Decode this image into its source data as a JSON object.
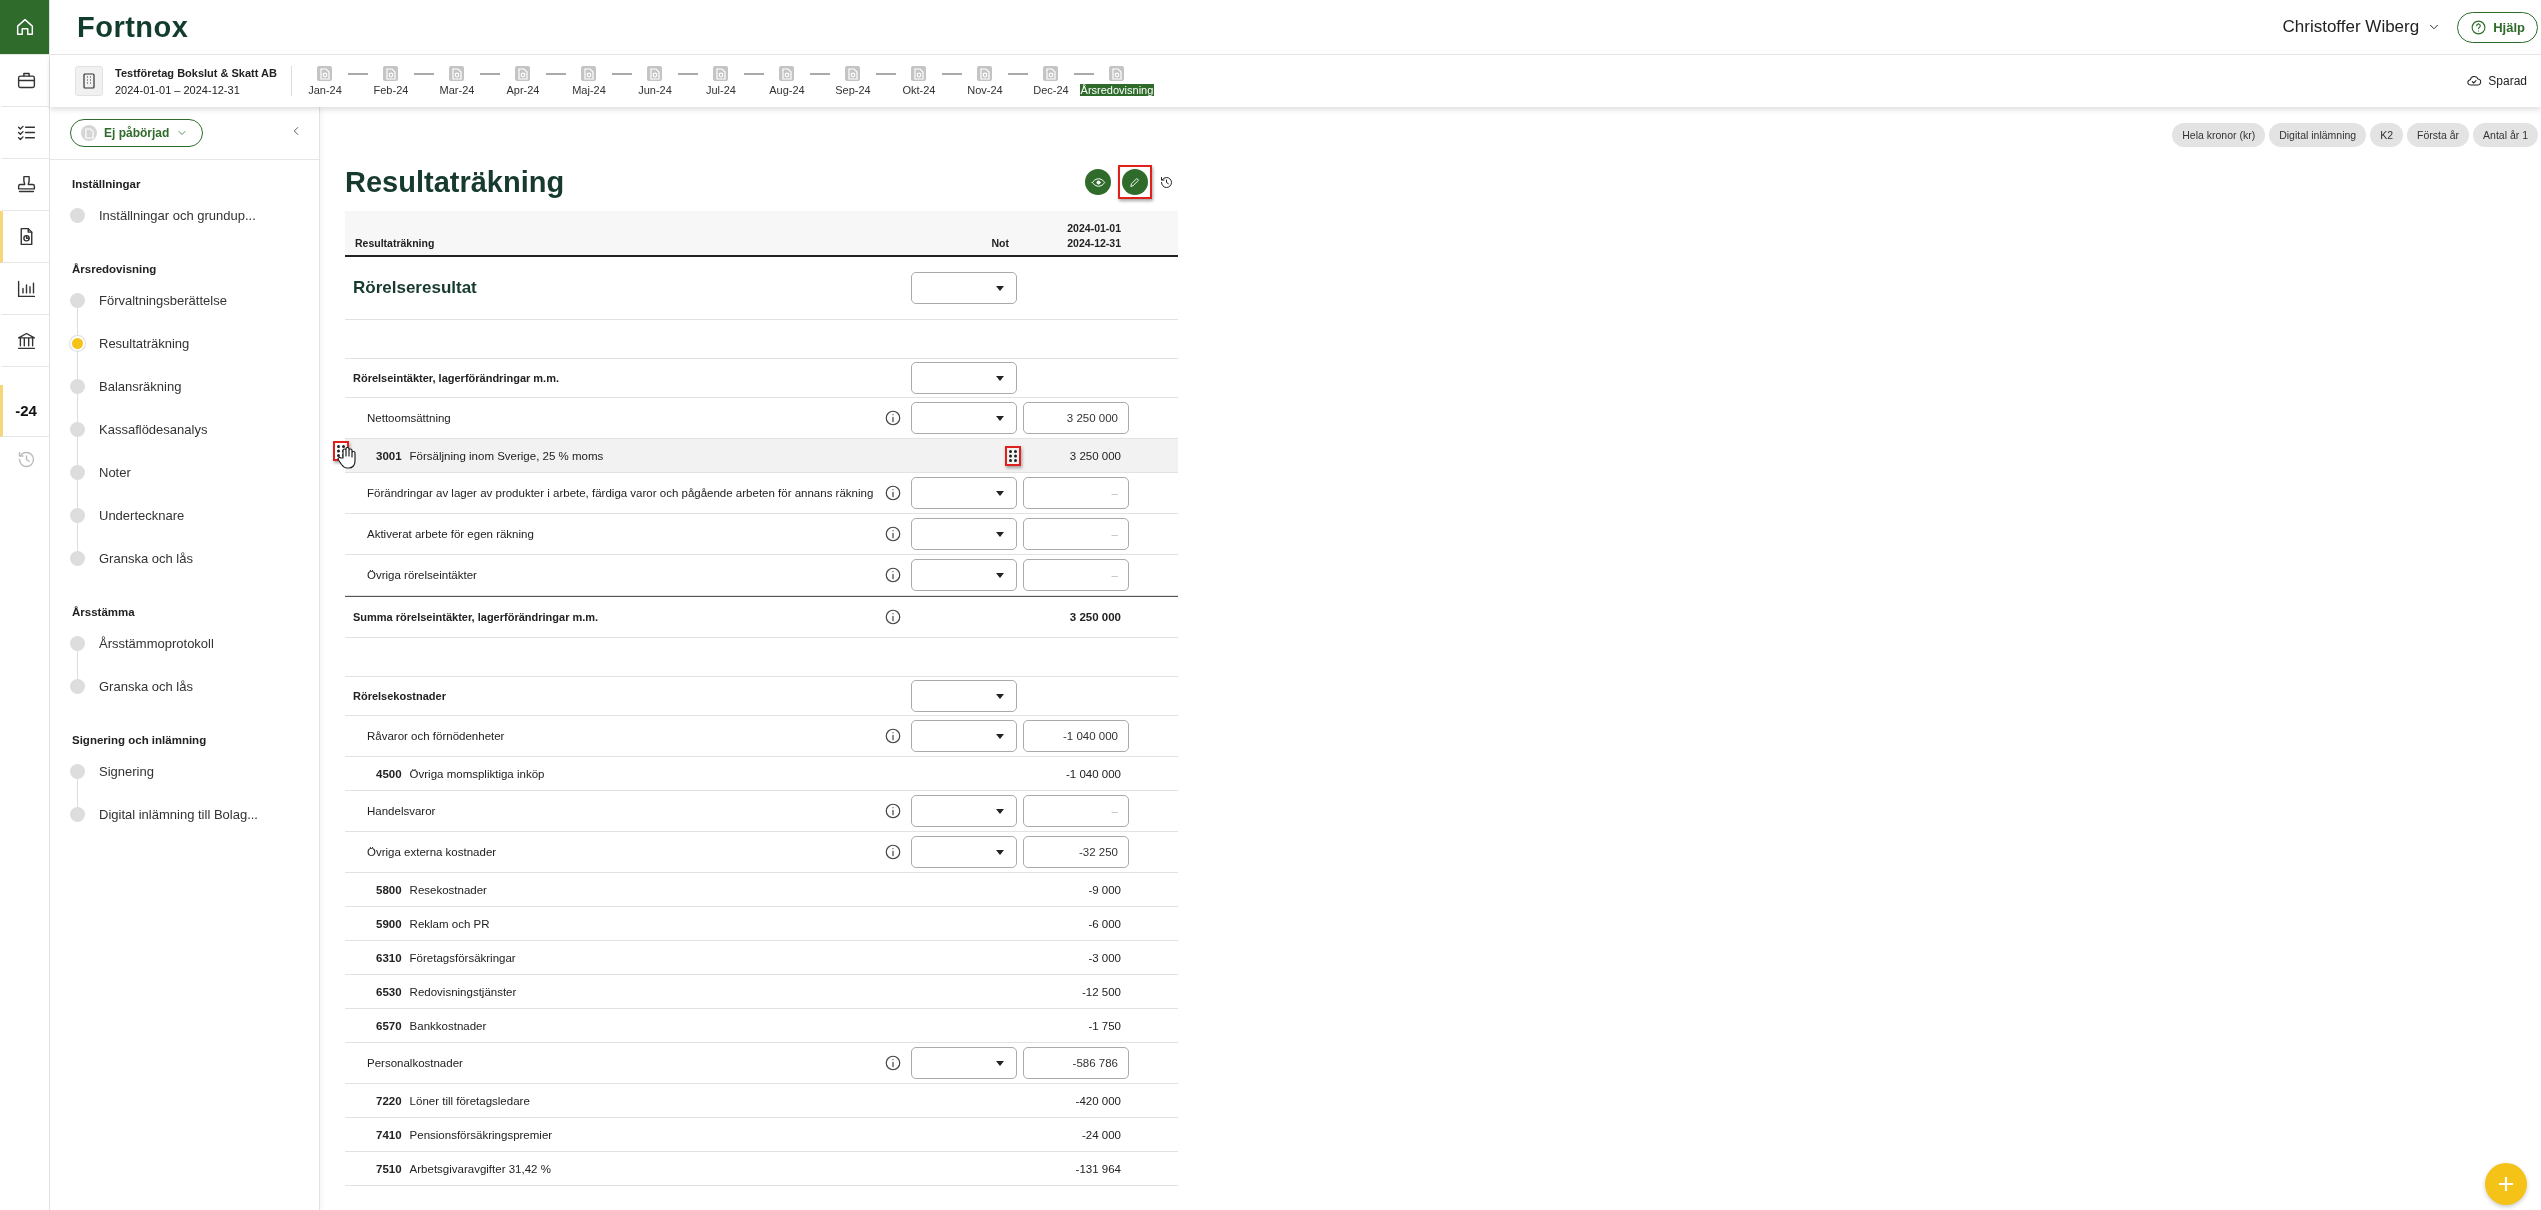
{
  "rail": {
    "items": [
      {
        "kind": "home",
        "selected": true
      },
      {
        "kind": "briefcase",
        "selected": false
      },
      {
        "kind": "checklist",
        "selected": false
      },
      {
        "kind": "stamp",
        "selected": false
      },
      {
        "kind": "report",
        "selected": true
      },
      {
        "kind": "chart",
        "selected": false
      },
      {
        "kind": "bank",
        "selected": false
      },
      {
        "kind": "year",
        "label": "-24",
        "selected": true
      },
      {
        "kind": "history",
        "selected": false
      }
    ]
  },
  "topbar": {
    "logo": "Fortnox",
    "user": "Christoffer Wiberg",
    "help": "Hjälp"
  },
  "company": {
    "name": "Testföretag Bokslut & Skatt AB",
    "period": "2024-01-01 – 2024-12-31"
  },
  "timeline": [
    {
      "label": "Jan-24",
      "selected": false
    },
    {
      "label": "Feb-24",
      "selected": false
    },
    {
      "label": "Mar-24",
      "selected": false
    },
    {
      "label": "Apr-24",
      "selected": false
    },
    {
      "label": "Maj-24",
      "selected": false
    },
    {
      "label": "Jun-24",
      "selected": false
    },
    {
      "label": "Jul-24",
      "selected": false
    },
    {
      "label": "Aug-24",
      "selected": false
    },
    {
      "label": "Sep-24",
      "selected": false
    },
    {
      "label": "Okt-24",
      "selected": false
    },
    {
      "label": "Nov-24",
      "selected": false
    },
    {
      "label": "Dec-24",
      "selected": false
    },
    {
      "label": "Årsredovisning",
      "selected": true
    }
  ],
  "save_status": "Sparad",
  "sidebar": {
    "status": "Ej påbörjad",
    "sections": [
      {
        "title": "Inställningar",
        "items": [
          {
            "label": "Inställningar och grundup...",
            "selected": false
          }
        ]
      },
      {
        "title": "Årsredovisning",
        "items": [
          {
            "label": "Förvaltningsberättelse",
            "selected": false
          },
          {
            "label": "Resultaträkning",
            "selected": true
          },
          {
            "label": "Balansräkning",
            "selected": false
          },
          {
            "label": "Kassaflödesanalys",
            "selected": false
          },
          {
            "label": "Noter",
            "selected": false
          },
          {
            "label": "Undertecknare",
            "selected": false
          },
          {
            "label": "Granska och lås",
            "selected": false
          }
        ]
      },
      {
        "title": "Årsstämma",
        "items": [
          {
            "label": "Årsstämmoprotokoll",
            "selected": false
          },
          {
            "label": "Granska och lås",
            "selected": false
          }
        ]
      },
      {
        "title": "Signering och inlämning",
        "items": [
          {
            "label": "Signering",
            "selected": false
          },
          {
            "label": "Digital inlämning till Bolag...",
            "selected": false
          }
        ]
      }
    ]
  },
  "chips": [
    "Hela kronor (kr)",
    "Digital inlämning",
    "K2",
    "Första år",
    "Antal år 1"
  ],
  "report": {
    "title": "Resultaträkning",
    "edit_highlighted": true,
    "columns": {
      "label": "Resultaträkning",
      "note": "Not",
      "period_start": "2024-01-01",
      "period_end": "2024-12-31"
    },
    "rows": [
      {
        "kind": "heading",
        "label": "Rörelseresultat"
      },
      {
        "kind": "group",
        "label": "Rörelseintäkter, lagerförändringar m.m."
      },
      {
        "kind": "line",
        "label": "Nettoomsättning",
        "value": "3 250 000"
      },
      {
        "kind": "account",
        "number": "3001",
        "label": "Försäljning inom Sverige, 25 % moms",
        "value": "3 250 000",
        "hovered": true,
        "highlighted": true
      },
      {
        "kind": "line",
        "label": "Förändringar av lager av produkter i arbete, färdiga varor och pågående arbeten för annans räkning",
        "placeholder": "–"
      },
      {
        "kind": "line",
        "label": "Aktiverat arbete för egen räkning",
        "placeholder": "–"
      },
      {
        "kind": "line",
        "label": "Övriga rörelseintäkter",
        "placeholder": "–"
      },
      {
        "kind": "total",
        "label": "Summa rörelseintäkter, lagerförändringar m.m.",
        "value": "3 250 000"
      },
      {
        "kind": "group",
        "label": "Rörelsekostnader"
      },
      {
        "kind": "line",
        "label": "Råvaror och förnödenheter",
        "value": "-1 040 000"
      },
      {
        "kind": "account",
        "number": "4500",
        "label": "Övriga momspliktiga inköp",
        "value": "-1 040 000",
        "hovered": false
      },
      {
        "kind": "line",
        "label": "Handelsvaror",
        "placeholder": "–"
      },
      {
        "kind": "line",
        "label": "Övriga externa kostnader",
        "value": "-32 250"
      },
      {
        "kind": "account",
        "number": "5800",
        "label": "Resekostnader",
        "value": "-9 000",
        "hovered": false
      },
      {
        "kind": "account",
        "number": "5900",
        "label": "Reklam och PR",
        "value": "-6 000",
        "hovered": false
      },
      {
        "kind": "account",
        "number": "6310",
        "label": "Företagsförsäkringar",
        "value": "-3 000",
        "hovered": false
      },
      {
        "kind": "account",
        "number": "6530",
        "label": "Redovisningstjänster",
        "value": "-12 500",
        "hovered": false
      },
      {
        "kind": "account",
        "number": "6570",
        "label": "Bankkostnader",
        "value": "-1 750",
        "hovered": false
      },
      {
        "kind": "line",
        "label": "Personalkostnader",
        "value": "-586 786"
      },
      {
        "kind": "account",
        "number": "7220",
        "label": "Löner till företagsledare",
        "value": "-420 000",
        "hovered": false
      },
      {
        "kind": "account",
        "number": "7410",
        "label": "Pensionsförsäkringspremier",
        "value": "-24 000",
        "hovered": false
      },
      {
        "kind": "account",
        "number": "7510",
        "label": "Arbetsgivaravgifter 31,42 %",
        "value": "-131 964",
        "hovered": false
      }
    ]
  }
}
